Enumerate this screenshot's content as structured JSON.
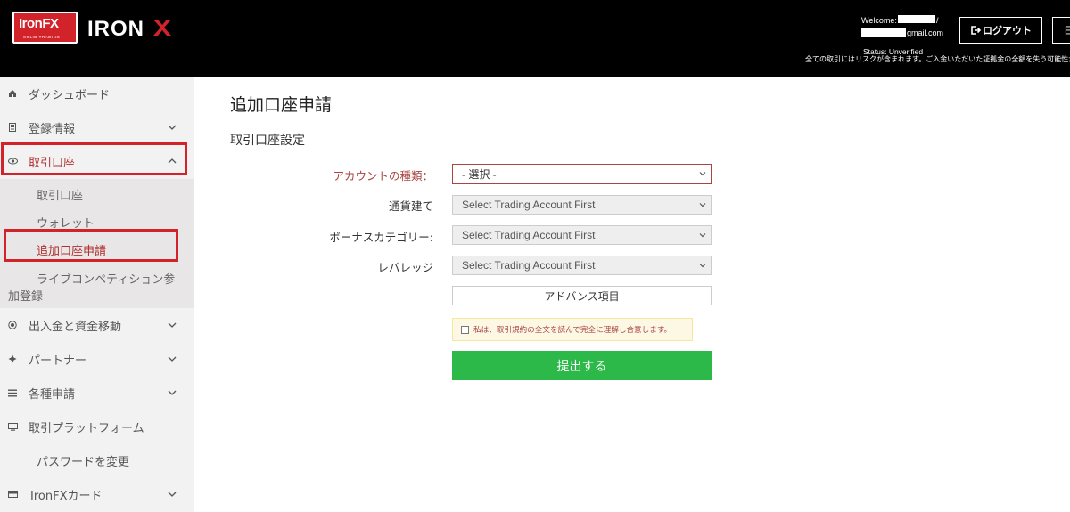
{
  "header": {
    "logo_brand": "IronFX",
    "logo_tagline": "SOLID TRADING",
    "ironx_text": "IRON",
    "welcome_label": "Welcome:",
    "slash": "/",
    "email_domain": "gmail.com",
    "status": "Status: Unverified",
    "risk_notice": "全ての取引にはリスクが含まれます。ご入金いただいた証拠金の全額を失う可能性が",
    "logout_label": "ログアウト",
    "lang_label": "日",
    "colors": {
      "bg": "#000000",
      "brand_red": "#d2232a"
    }
  },
  "sidebar": {
    "items": [
      {
        "label": "ダッシュボード",
        "icon": "home-icon"
      },
      {
        "label": "登録情報",
        "icon": "id-card-icon"
      },
      {
        "label": "取引口座",
        "icon": "eye-icon"
      },
      {
        "label": "出入金と資金移動",
        "icon": "transfer-icon"
      },
      {
        "label": "パートナー",
        "icon": "partner-icon"
      },
      {
        "label": "各種申請",
        "icon": "list-icon"
      },
      {
        "label": "取引プラットフォーム",
        "icon": "desktop-icon"
      },
      {
        "label": "パスワードを変更",
        "icon": ""
      },
      {
        "label": "IronFXカード",
        "icon": "card-icon"
      }
    ],
    "submenu": [
      {
        "label": "取引口座"
      },
      {
        "label": "ウォレット"
      },
      {
        "label": "追加口座申請"
      },
      {
        "label_line1": "ライブコンペティション参",
        "label_line2": "加登録"
      }
    ]
  },
  "main": {
    "page_title": "追加口座申請",
    "section_title": "取引口座設定",
    "form": {
      "account_type": {
        "label": "アカウントの種類：",
        "value": "- 選択 -"
      },
      "currency": {
        "label": "通貨建て",
        "value": "Select Trading Account First"
      },
      "bonus": {
        "label": "ボーナスカテゴリー:",
        "value": "Select Trading Account First"
      },
      "leverage": {
        "label": "レバレッジ",
        "value": "Select Trading Account First"
      },
      "advanced_label": "アドバンス項目",
      "terms_text": "私は、取引規約の全文を読んで完全に理解し合意します。",
      "terms_checked": false,
      "submit_label": "提出する"
    },
    "colors": {
      "submit": "#2db84a",
      "required": "#a94442",
      "highlight": "#d2232a"
    }
  }
}
